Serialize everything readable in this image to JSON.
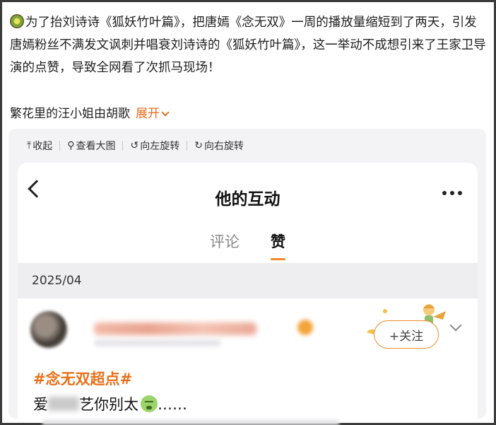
{
  "post": {
    "emoji_icon": "kiwi-emoji-icon",
    "text": "为了抬刘诗诗《狐妖竹叶篇》，把唐嫣《念无双》一周的播放量缩短到了两天，引发唐嫣粉丝不满发文讽刺并唱衰刘诗诗的《狐妖竹叶篇》，这一举动不成想引来了王家卫导演的点赞，导致全网看了次抓马现场！",
    "author": "繁花里的汪小姐由胡歌",
    "expand_label": "展开"
  },
  "toolbar": {
    "collapse_label": "收起",
    "view_large_label": "查看大图",
    "rotate_left_label": "向左旋转",
    "rotate_right_label": "向右旋转"
  },
  "phone": {
    "title": "他的互动",
    "tabs": [
      {
        "label": "评论",
        "active": false
      },
      {
        "label": "赞",
        "active": true
      }
    ],
    "date_header": "2025/04",
    "follow_label": "+关注",
    "hashtag": "#念无双超点#",
    "content_prefix": "爱",
    "content_suffix": "艺你别太",
    "content_ellipsis": "……",
    "accent_color": "#f08a2c"
  }
}
